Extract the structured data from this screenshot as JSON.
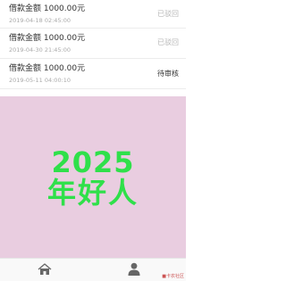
{
  "loans": [
    {
      "amount_text": "借款金额 1000.00元",
      "date": "2019-04-18 02:45:00",
      "status": "已驳回"
    },
    {
      "amount_text": "借款金额 1000.00元",
      "date": "2019-04-30 21:45:00",
      "status": "已驳回"
    },
    {
      "amount_text": "借款金额 1000.00元",
      "date": "2019-05-11 04:00:10",
      "status": "待审核"
    }
  ],
  "banner": {
    "line1": "2025",
    "line2": "年好人",
    "background": "#e9cde0",
    "text_color": "#2fe04a"
  },
  "tabbar": {
    "items": [
      {
        "icon": "home-icon"
      },
      {
        "icon": "user-icon"
      }
    ]
  },
  "watermark": "■卡农社区"
}
